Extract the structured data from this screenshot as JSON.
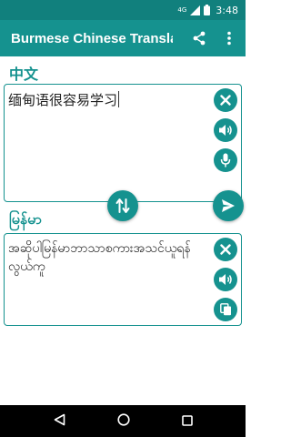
{
  "status_bar": {
    "signal_label": "4G",
    "time": "3:48"
  },
  "app_bar": {
    "title": "Burmese Chinese Translator",
    "share_icon": "share-icon",
    "menu_icon": "more-vert-icon"
  },
  "source": {
    "language": "中文",
    "text": "缅甸语很容易学习"
  },
  "target": {
    "language": "မြန်မာ",
    "text": "အဆိုပါမြန်မာဘာသာစကားအသင်ယူရန်လွယ်ကူ"
  },
  "colors": {
    "primary": "#15928f",
    "status_bar": "#11807d",
    "nav_bar": "#000000"
  },
  "icons": {
    "clear": "close-icon",
    "speak": "speaker-icon",
    "mic": "microphone-icon",
    "swap": "swap-vertical-icon",
    "translate": "send-icon",
    "copy": "copy-icon",
    "nav_back": "back-triangle-icon",
    "nav_home": "home-circle-icon",
    "nav_recents": "recents-square-icon"
  }
}
